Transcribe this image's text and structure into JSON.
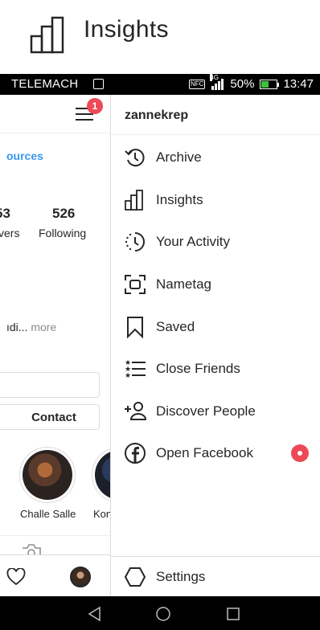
{
  "zoom_caption": {
    "label": "Insights",
    "icon": "insights-bar-chart-icon"
  },
  "status_bar": {
    "carrier": "TELEMACH",
    "nfc": "NFC",
    "network": "4G",
    "battery": "50%",
    "time": "13:47"
  },
  "background_profile": {
    "notification_count": "1",
    "resources_link": "ources",
    "followers_count": "53",
    "followers_label": "vers",
    "following_count": "526",
    "following_label": "Following",
    "bio_text": "ıdi...",
    "bio_more": " more",
    "contact_label": "Contact",
    "stories": [
      {
        "label": "Challe Salle"
      },
      {
        "label": "Kon"
      }
    ]
  },
  "drawer": {
    "username": "zannekrep",
    "items": [
      {
        "label": "Archive",
        "icon": "archive-history-icon"
      },
      {
        "label": "Insights",
        "icon": "insights-bar-chart-icon"
      },
      {
        "label": "Your Activity",
        "icon": "activity-clock-icon"
      },
      {
        "label": "Nametag",
        "icon": "nametag-scan-icon"
      },
      {
        "label": "Saved",
        "icon": "bookmark-icon"
      },
      {
        "label": "Close Friends",
        "icon": "close-friends-list-icon"
      },
      {
        "label": "Discover People",
        "icon": "add-person-icon"
      },
      {
        "label": "Open Facebook",
        "icon": "facebook-icon"
      }
    ],
    "settings_label": "Settings"
  },
  "colors": {
    "accent_blue": "#3897f0",
    "badge_red": "#ed4956",
    "text_dark": "#262626",
    "divider": "#dbdbdb"
  }
}
